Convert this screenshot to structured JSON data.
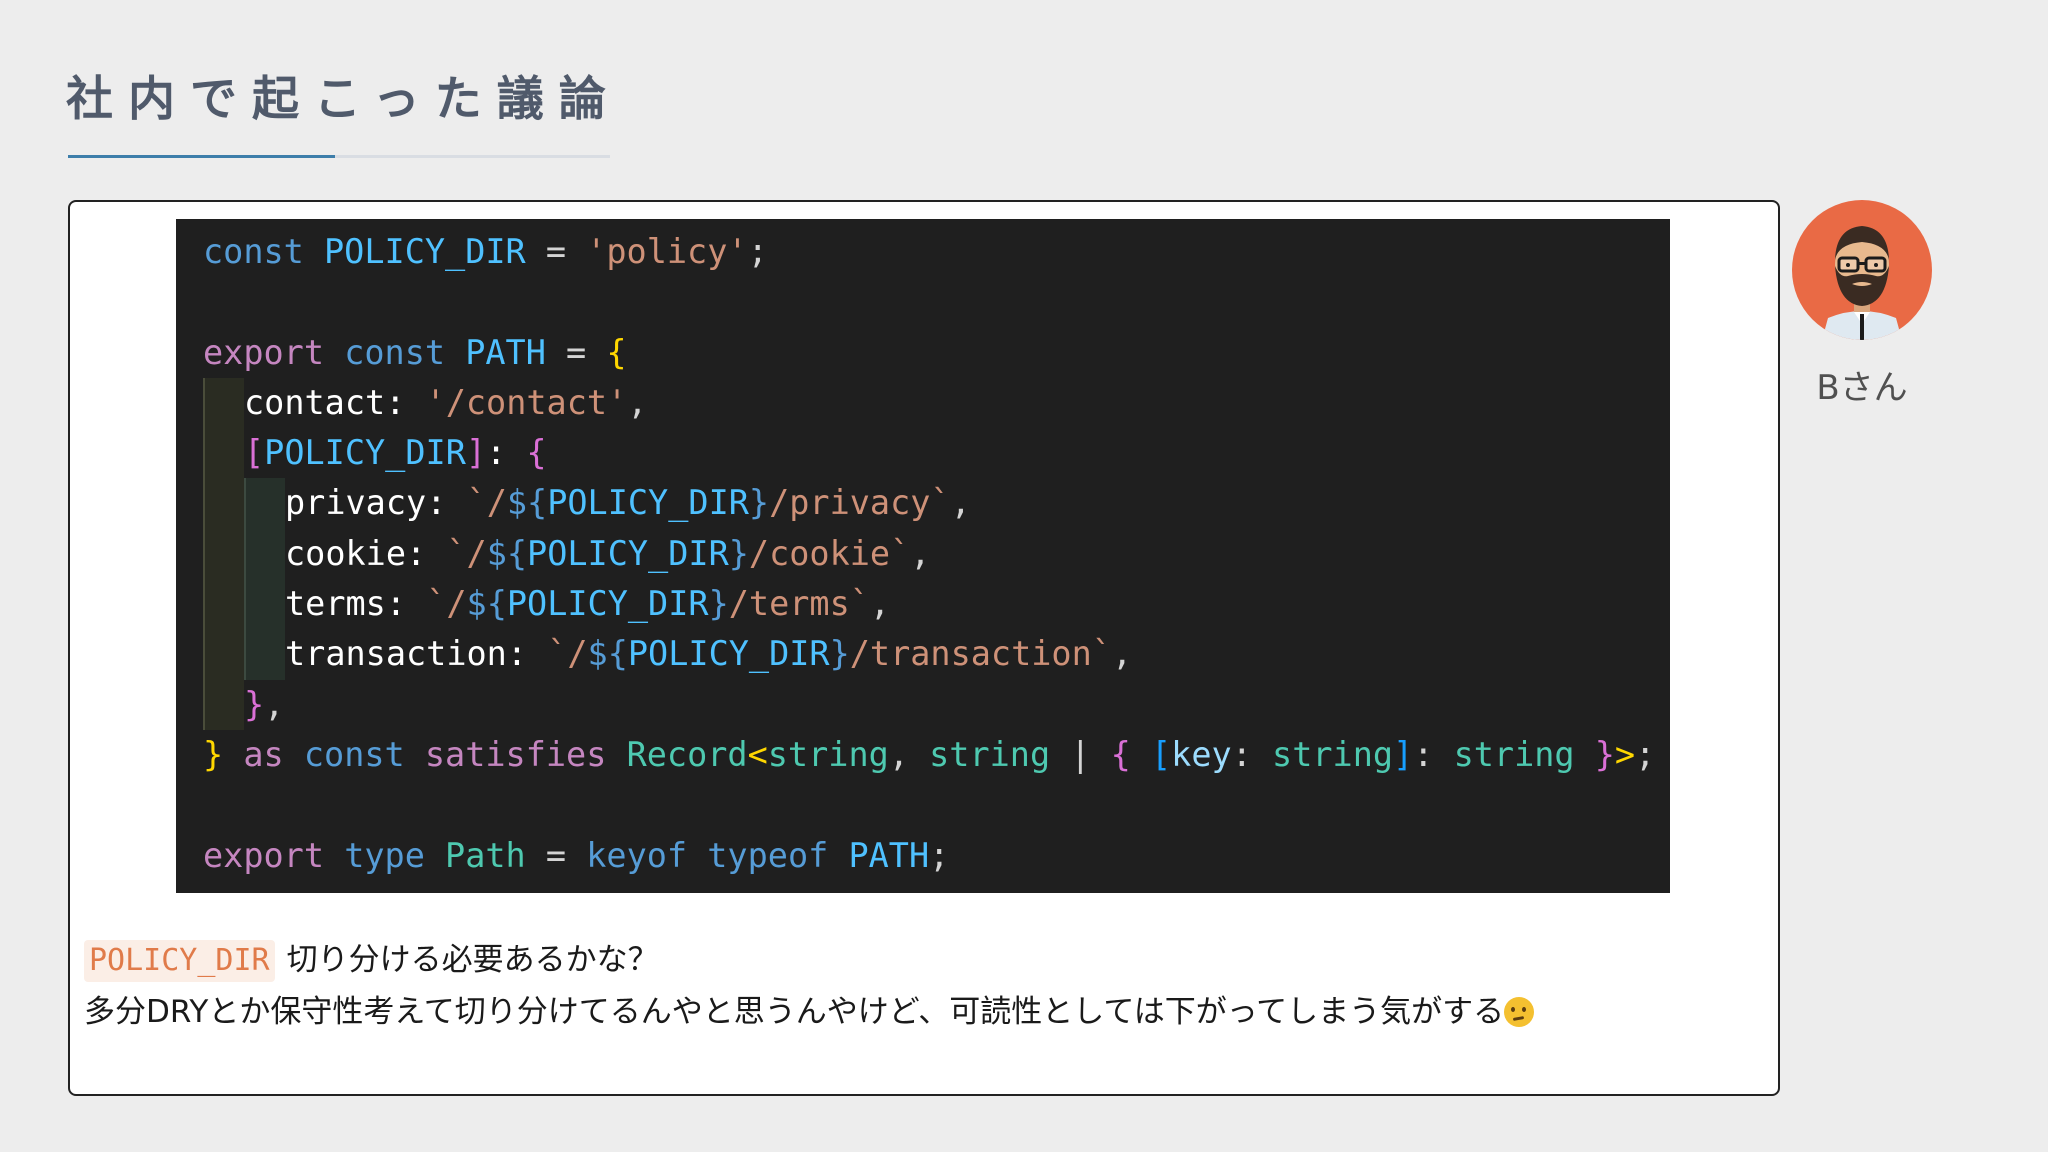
{
  "slide": {
    "title": "社内で起こった議論"
  },
  "code_block": {
    "lines": [
      {
        "indent": 0,
        "tokens": [
          [
            "kw",
            "const"
          ],
          [
            "plain",
            " "
          ],
          [
            "const",
            "POLICY_DIR"
          ],
          [
            "plain",
            " = "
          ],
          [
            "str",
            "'policy'"
          ],
          [
            "plain",
            ";"
          ]
        ]
      },
      {
        "indent": 0,
        "tokens": []
      },
      {
        "indent": 0,
        "tokens": [
          [
            "ctl",
            "export"
          ],
          [
            "plain",
            " "
          ],
          [
            "kw",
            "const"
          ],
          [
            "plain",
            " "
          ],
          [
            "const",
            "PATH"
          ],
          [
            "plain",
            " = "
          ],
          [
            "b1",
            "{"
          ]
        ]
      },
      {
        "indent": 1,
        "tokens": [
          [
            "bright",
            "contact"
          ],
          [
            "bright",
            ": "
          ],
          [
            "str",
            "'/contact'"
          ],
          [
            "plain",
            ","
          ]
        ]
      },
      {
        "indent": 1,
        "tokens": [
          [
            "b2",
            "["
          ],
          [
            "const",
            "POLICY_DIR"
          ],
          [
            "b2",
            "]"
          ],
          [
            "bright",
            ": "
          ],
          [
            "b2",
            "{"
          ]
        ]
      },
      {
        "indent": 2,
        "tokens": [
          [
            "bright",
            "privacy"
          ],
          [
            "bright",
            ": "
          ],
          [
            "str",
            "`/"
          ],
          [
            "kw",
            "${"
          ],
          [
            "const",
            "POLICY_DIR"
          ],
          [
            "kw",
            "}"
          ],
          [
            "str",
            "/privacy`"
          ],
          [
            "plain",
            ","
          ]
        ]
      },
      {
        "indent": 2,
        "tokens": [
          [
            "bright",
            "cookie"
          ],
          [
            "bright",
            ": "
          ],
          [
            "str",
            "`/"
          ],
          [
            "kw",
            "${"
          ],
          [
            "const",
            "POLICY_DIR"
          ],
          [
            "kw",
            "}"
          ],
          [
            "str",
            "/cookie`"
          ],
          [
            "plain",
            ","
          ]
        ]
      },
      {
        "indent": 2,
        "tokens": [
          [
            "bright",
            "terms"
          ],
          [
            "bright",
            ": "
          ],
          [
            "str",
            "`/"
          ],
          [
            "kw",
            "${"
          ],
          [
            "const",
            "POLICY_DIR"
          ],
          [
            "kw",
            "}"
          ],
          [
            "str",
            "/terms`"
          ],
          [
            "plain",
            ","
          ]
        ]
      },
      {
        "indent": 2,
        "tokens": [
          [
            "bright",
            "transaction"
          ],
          [
            "bright",
            ": "
          ],
          [
            "str",
            "`/"
          ],
          [
            "kw",
            "${"
          ],
          [
            "const",
            "POLICY_DIR"
          ],
          [
            "kw",
            "}"
          ],
          [
            "str",
            "/transaction`"
          ],
          [
            "plain",
            ","
          ]
        ]
      },
      {
        "indent": 1,
        "tokens": [
          [
            "b2",
            "}"
          ],
          [
            "plain",
            ","
          ]
        ]
      },
      {
        "indent": 0,
        "tokens": [
          [
            "b1",
            "}"
          ],
          [
            "plain",
            " "
          ],
          [
            "ctl",
            "as"
          ],
          [
            "plain",
            " "
          ],
          [
            "kw",
            "const"
          ],
          [
            "plain",
            " "
          ],
          [
            "ctl",
            "satisfies"
          ],
          [
            "plain",
            " "
          ],
          [
            "type",
            "Record"
          ],
          [
            "b1",
            "<"
          ],
          [
            "type",
            "string"
          ],
          [
            "plain",
            ", "
          ],
          [
            "type",
            "string"
          ],
          [
            "plain",
            " | "
          ],
          [
            "b2",
            "{"
          ],
          [
            "plain",
            " "
          ],
          [
            "b3",
            "["
          ],
          [
            "prop",
            "key"
          ],
          [
            "plain",
            ": "
          ],
          [
            "type",
            "string"
          ],
          [
            "b3",
            "]"
          ],
          [
            "plain",
            ": "
          ],
          [
            "type",
            "string"
          ],
          [
            "plain",
            " "
          ],
          [
            "b2",
            "}"
          ],
          [
            "b1",
            ">"
          ],
          [
            "plain",
            ";"
          ]
        ]
      },
      {
        "indent": 0,
        "tokens": []
      },
      {
        "indent": 0,
        "tokens": [
          [
            "ctl",
            "export"
          ],
          [
            "plain",
            " "
          ],
          [
            "kw",
            "type"
          ],
          [
            "plain",
            " "
          ],
          [
            "type",
            "Path"
          ],
          [
            "plain",
            " = "
          ],
          [
            "kw",
            "keyof"
          ],
          [
            "plain",
            " "
          ],
          [
            "kw",
            "typeof"
          ],
          [
            "plain",
            " "
          ],
          [
            "const",
            "PATH"
          ],
          [
            "plain",
            ";"
          ]
        ]
      }
    ]
  },
  "comment": {
    "inline_code": "POLICY_DIR",
    "line1_rest": "切り分ける必要あるかな？",
    "line2": "多分DRYとか保守性考えて切り分けてるんやと思うんやけど、可読性としては下がってしまう気がする",
    "emoji": "thinking-face-emoji"
  },
  "speaker": {
    "name": "Bさん",
    "avatar_icon": "bearded-man-avatar"
  },
  "colors": {
    "accent": "#3d7eaa",
    "avatar_bg": "#e96a45",
    "code_bg": "#1f1f1f"
  }
}
